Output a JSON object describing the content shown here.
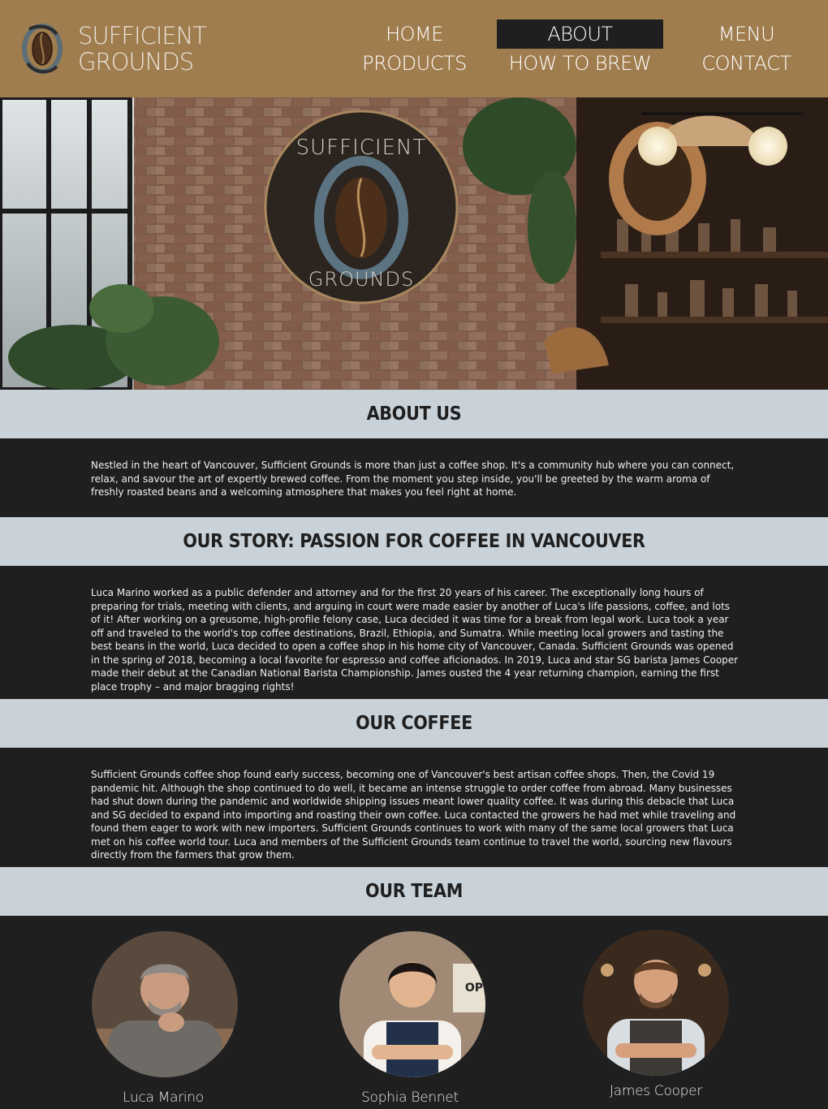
{
  "brand": {
    "line1": "SUFFICIENT",
    "line2": "GROUNDS"
  },
  "nav": {
    "home": "HOME",
    "about": "ABOUT",
    "menu": "MENU",
    "products": "PRODUCTS",
    "how_to_brew": "HOW TO BREW",
    "contact": "CONTACT"
  },
  "hero": {
    "sign_top": "SUFFICIENT",
    "sign_bottom": "GROUNDS"
  },
  "sections": {
    "about": {
      "title": "ABOUT US",
      "text": "Nestled in the heart of Vancouver, Sufficient Grounds is more than just a coffee shop. It's a community hub where you can connect, relax, and savour the art of expertly brewed coffee. From the moment you step inside, you'll be greeted by the warm aroma of freshly roasted beans and a welcoming atmosphere that makes you feel right at home."
    },
    "story": {
      "title": "OUR STORY: PASSION FOR COFFEE IN VANCOUVER",
      "text": "Luca Marino worked as a public defender and attorney and for the first 20 years of his career. The exceptionally long hours of preparing for trials, meeting with clients, and arguing in court were made easier by another of Luca's life passions, coffee, and lots of it! After working on a greusome, high-profile felony case, Luca decided it was time for a break from legal work. Luca took a year off and traveled to the world's top coffee destinations, Brazil, Ethiopia, and Sumatra. While meeting local growers and tasting the best beans in the world, Luca decided to open a coffee shop in his home city of Vancouver, Canada. Sufficient Grounds was opened in the spring of 2018, becoming a local favorite for espresso and coffee aficionados. In 2019, Luca and star SG barista James Cooper made their debut at the Canadian National Barista Championship. James ousted the 4 year returning champion, earning the first place trophy – and major bragging rights!"
    },
    "coffee": {
      "title": "OUR COFFEE",
      "text": "Sufficient Grounds coffee shop found early success, becoming one of Vancouver's best artisan coffee shops. Then, the Covid 19 pandemic hit. Although the shop continued to do well, it became an intense struggle to order coffee from abroad. Many businesses had shut down during the pandemic and worldwide shipping issues meant lower quality coffee. It was during this debacle that Luca and SG decided to expand into importing and roasting their own coffee. Luca contacted the growers he had met while traveling and found them eager to work with new importers. Sufficient Grounds continues to work with many of the same local growers that Luca met on his coffee world tour. Luca and members of the Sufficient Grounds team continue to travel the world, sourcing new flavours directly from the farmers that grow them."
    },
    "team": {
      "title": "OUR TEAM",
      "members": [
        {
          "name": "Luca Marino"
        },
        {
          "name": "Sophia Bennet"
        },
        {
          "name": "James Cooper"
        }
      ],
      "shop_sign": "OP"
    }
  },
  "colors": {
    "header": "#a07d4e",
    "band": "#c9d2d8",
    "dark": "#1f1f20",
    "text_light": "#f0f0f0"
  }
}
